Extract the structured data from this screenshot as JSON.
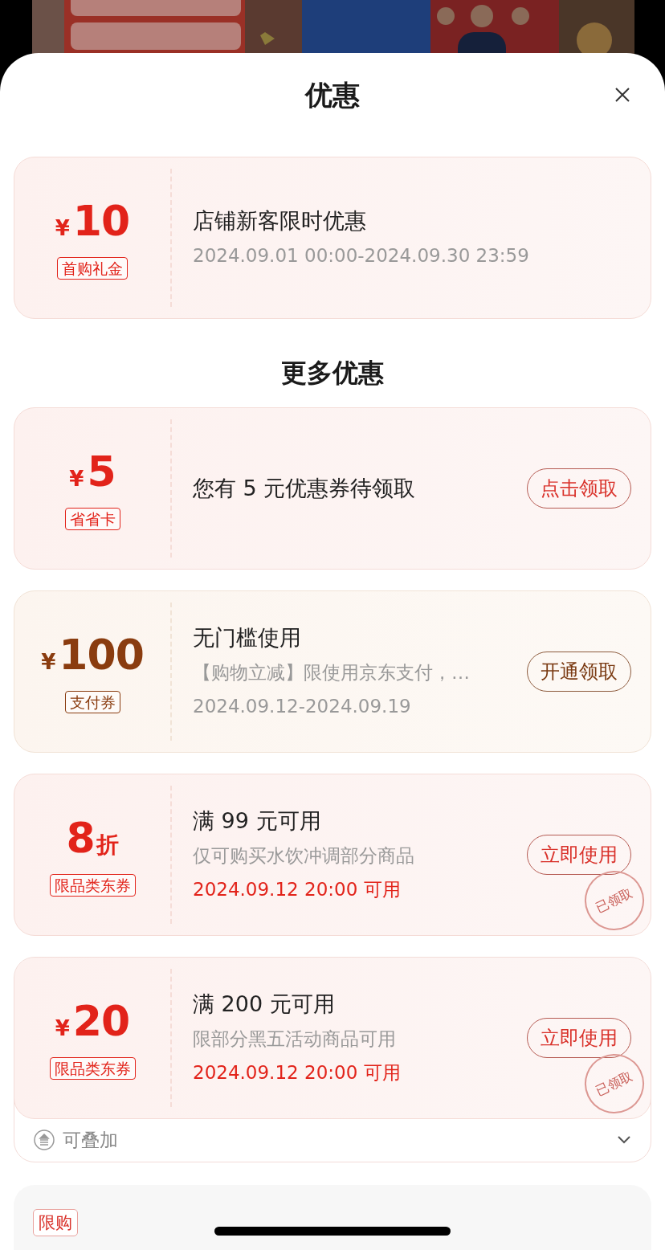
{
  "title": "优惠",
  "first_offer": {
    "kind": "amount",
    "color": "#e2231a",
    "currency": "¥",
    "value": "10",
    "tag": "首购礼金",
    "title": "店铺新客限时优惠",
    "lines": [
      {
        "text": "2024.09.01 00:00-2024.09.30 23:59",
        "kind": "muted"
      }
    ]
  },
  "section_title": "更多优惠",
  "offers": [
    {
      "kind": "amount",
      "color": "#e2231a",
      "currency": "¥",
      "value": "5",
      "tag": "省省卡",
      "title": "您有 5 元优惠券待领取",
      "button": "点击领取",
      "claimed": false
    },
    {
      "kind": "amount",
      "color": "#8a3c0f",
      "currency": "¥",
      "value": "100",
      "tag": "支付券",
      "title": "无门槛使用",
      "lines": [
        {
          "text": "【购物立减】限使用京东支付，…",
          "kind": "muted"
        },
        {
          "text": "2024.09.12-2024.09.19",
          "kind": "muted"
        }
      ],
      "button": "开通领取",
      "claimed": false
    },
    {
      "kind": "discount",
      "color": "#e2231a",
      "value": "8",
      "unit": "折",
      "tag": "限品类东券",
      "title": "满 99 元可用",
      "lines": [
        {
          "text": "仅可购买水饮冲调部分商品",
          "kind": "muted"
        },
        {
          "text": "2024.09.12 20:00 可用",
          "kind": "accent"
        }
      ],
      "button": "立即使用",
      "claimed": true,
      "stamp": "已领取"
    },
    {
      "kind": "amount",
      "color": "#e2231a",
      "currency": "¥",
      "value": "20",
      "tag": "限品类东券",
      "title": "满 200 元可用",
      "lines": [
        {
          "text": "限部分黑五活动商品可用",
          "kind": "muted"
        },
        {
          "text": "2024.09.12 20:00 可用",
          "kind": "accent"
        }
      ],
      "button": "立即使用",
      "claimed": true,
      "stamp": "已领取"
    }
  ],
  "stack_row": {
    "label": "可叠加",
    "expanded": false
  },
  "next_item": {
    "tag": "限购"
  }
}
